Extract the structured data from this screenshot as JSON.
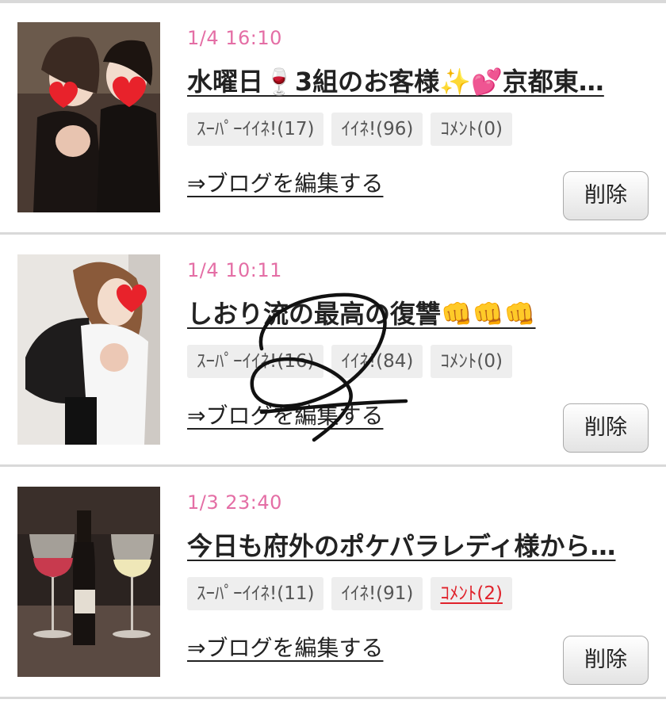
{
  "posts": [
    {
      "date": "1/4 16:10",
      "title": "水曜日🍷3組のお客様✨💕京都東…",
      "tags": {
        "super_like": "ｽｰﾊﾟｰｲｲﾈ!(17)",
        "like": "ｲｲﾈ!(96)",
        "comment": "ｺﾒﾝﾄ(0)"
      },
      "edit_link": "⇒ブログを編集する",
      "delete_label": "削除",
      "comment_active": false
    },
    {
      "date": "1/4 10:11",
      "title": "しおり流の最高の復讐👊👊👊",
      "tags": {
        "super_like": "ｽｰﾊﾟｰｲｲﾈ!(16)",
        "like": "ｲｲﾈ!(84)",
        "comment": "ｺﾒﾝﾄ(0)"
      },
      "edit_link": "⇒ブログを編集する",
      "delete_label": "削除",
      "comment_active": false
    },
    {
      "date": "1/3 23:40",
      "title": "今日も府外のポケパラレディ様から…",
      "tags": {
        "super_like": "ｽｰﾊﾟｰｲｲﾈ!(11)",
        "like": "ｲｲﾈ!(91)",
        "comment": "ｺﾒﾝﾄ(2)"
      },
      "edit_link": "⇒ブログを編集する",
      "delete_label": "削除",
      "comment_active": true
    }
  ],
  "colors": {
    "date": "#e46ea5",
    "comment_active": "#e0222b",
    "tag_bg": "#eeeeee"
  }
}
